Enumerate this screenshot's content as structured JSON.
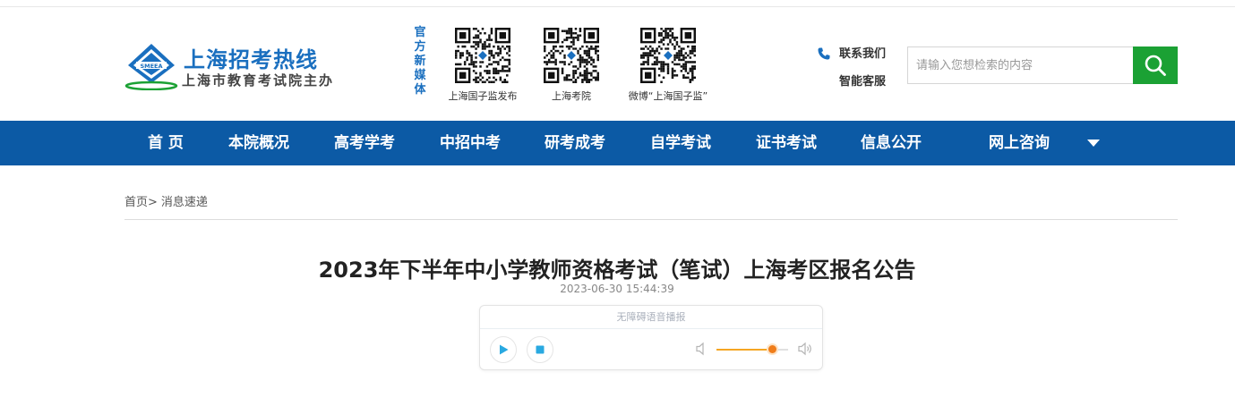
{
  "header": {
    "site_title": "上海招考热线",
    "site_subtitle": "上海市教育考试院主办",
    "media_label": "官方新媒体",
    "qr_codes": [
      {
        "caption": "上海国子监发布"
      },
      {
        "caption": "上海考院"
      },
      {
        "caption": "微博“上海国子监”"
      }
    ],
    "contact_label": "联系我们",
    "service_label": "智能客服",
    "search": {
      "placeholder": "请输入您想检索的内容"
    }
  },
  "nav": {
    "items": [
      "首 页",
      "本院概况",
      "高考学考",
      "中招中考",
      "研考成考",
      "自学考试",
      "证书考试",
      "信息公开",
      "网上咨询"
    ]
  },
  "breadcrumb": {
    "home": "首页>",
    "current": "消息速递"
  },
  "article": {
    "title": "2023年下半年中小学教师资格考试（笔试）上海考区报名公告",
    "timestamp": "2023-06-30 15:44:39"
  },
  "player": {
    "title": "无障碍语音播报",
    "volume": 0.78
  },
  "colors": {
    "brand_blue": "#0c5aa5",
    "title_blue": "#1a6fbf",
    "search_green": "#1ba134",
    "volume_orange": "#f07d1a",
    "play_blue": "#29a9e1"
  },
  "icons": [
    "logo-emblem-icon",
    "qr-code-icon",
    "phone-icon",
    "search-icon",
    "chevron-down-icon",
    "play-icon",
    "stop-icon",
    "volume-low-icon",
    "volume-high-icon"
  ]
}
